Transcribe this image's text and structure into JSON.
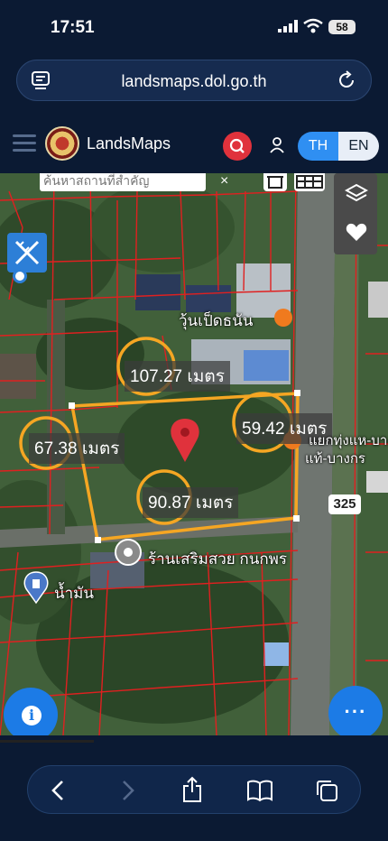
{
  "status_bar": {
    "time": "17:51",
    "battery": "58"
  },
  "browser": {
    "url": "landsmaps.dol.go.th"
  },
  "app": {
    "brand": "LandsMaps",
    "lang_th": "TH",
    "lang_en": "EN"
  },
  "map": {
    "search_placeholder": "ค้นหาสถานที่สำคัญ",
    "close": "×",
    "measurements": [
      {
        "value": "107.27 เมตร"
      },
      {
        "value": "59.42 เมตร"
      },
      {
        "value": "67.38 เมตร"
      },
      {
        "value": "90.87 เมตร"
      }
    ],
    "places": [
      {
        "label": "วุ้นเป็ดธนัน"
      },
      {
        "label": "ร้านเสริมสวย กนกพร"
      },
      {
        "label": "น้ำมัน"
      },
      {
        "label": "แยกทุ่งแห-บางกร"
      },
      {
        "label": "แท้-บางกร"
      }
    ],
    "road_number": "325"
  },
  "colors": {
    "accent": "#2f8ff2",
    "parcel_outline": "#f5a623",
    "parcel_lines": "#e02020",
    "fab": "#1c7be6"
  }
}
